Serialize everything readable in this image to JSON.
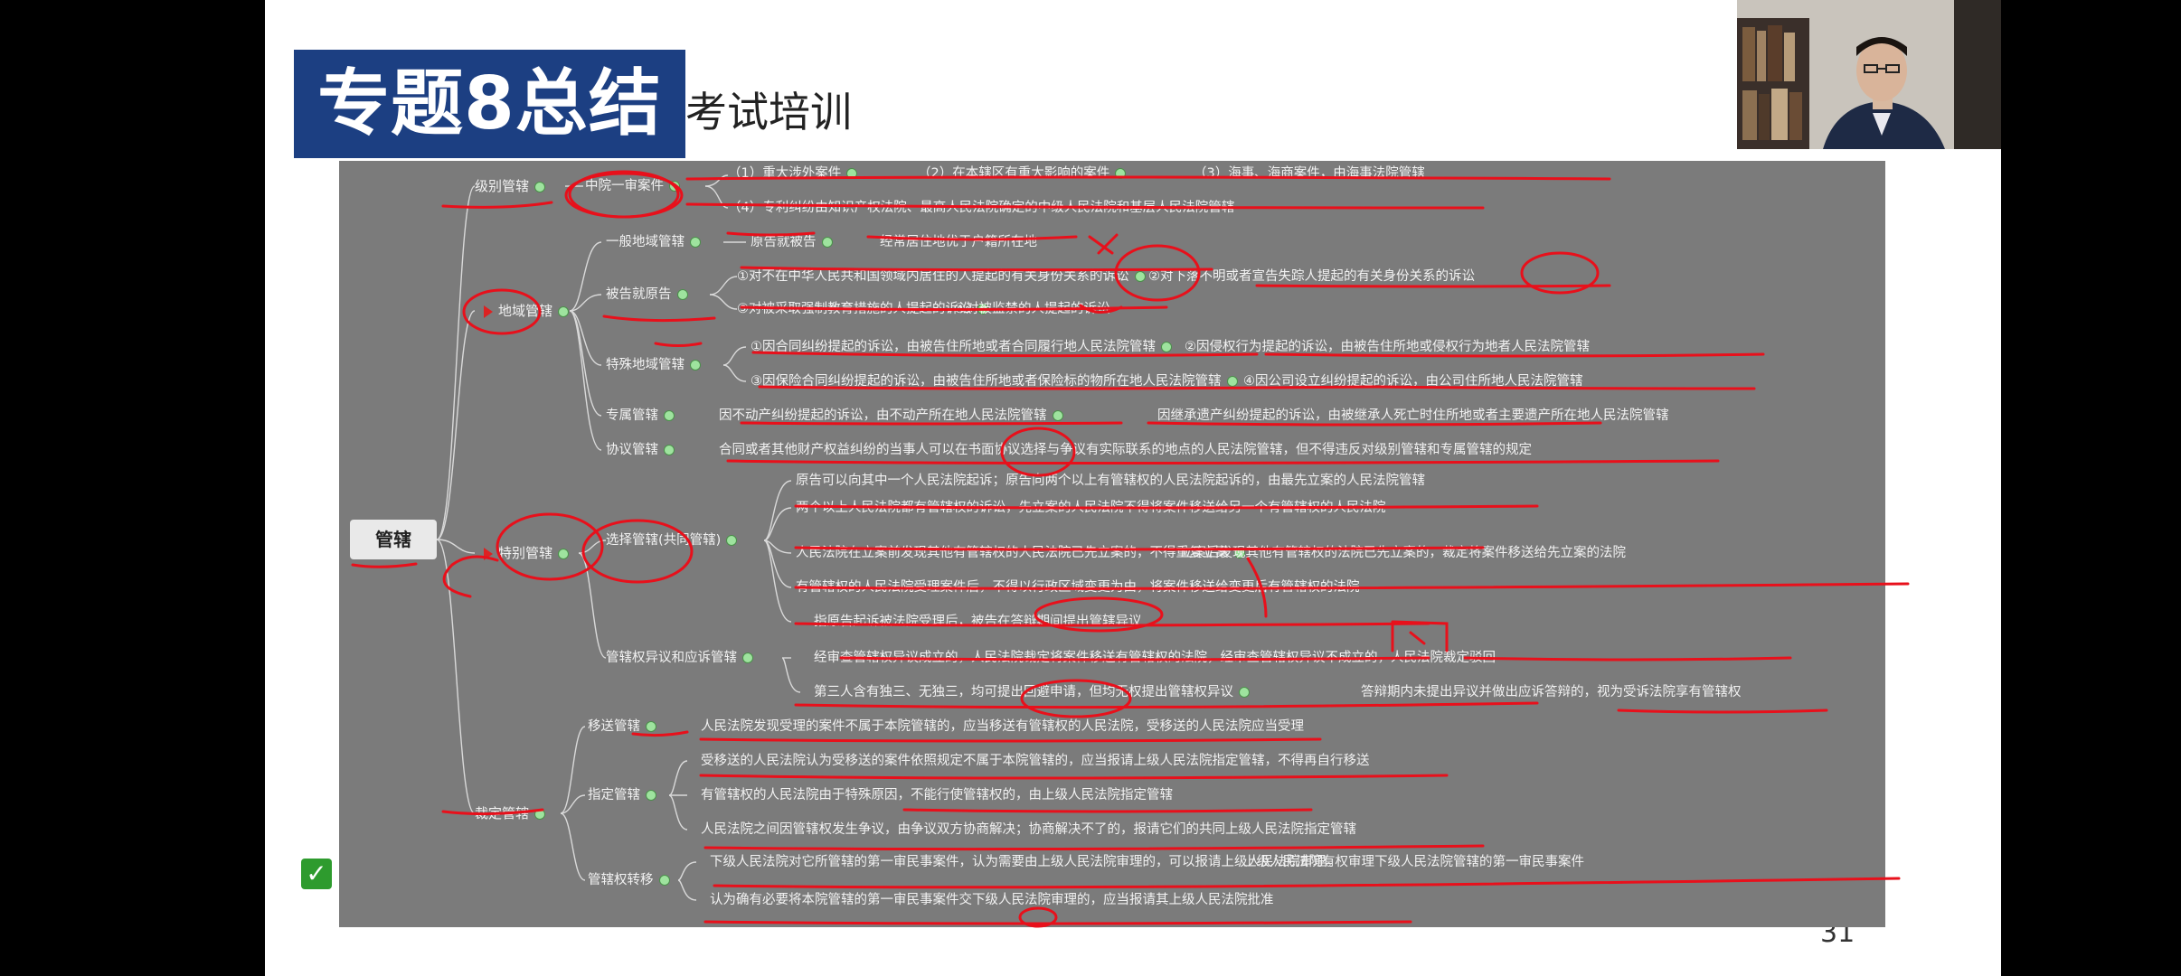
{
  "slide": {
    "title": "专题8总结",
    "subtitle": "考试培训",
    "page_number": "31"
  },
  "mindmap": {
    "root": "管辖",
    "level_jurisdiction": {
      "label": "级别管辖",
      "middle_court": "中院一审案件",
      "items": [
        "（1）重大涉外案件",
        "（2）在本辖区有重大影响的案件",
        "（3）海事、海商案件，由海事法院管辖",
        "（4）专利纠纷由知识产权法院、最高人民法院确定的中级人民法院和基层人民法院管辖"
      ]
    },
    "territorial": {
      "label": "地域管辖",
      "general": {
        "label": "一般地域管辖",
        "items": [
          "原告就被告",
          "经常居住地优于户籍所在地"
        ]
      },
      "defendant_follows_plaintiff": {
        "label": "被告就原告",
        "items": [
          "①对不在中华人民共和国领域内居住的人提起的有关身份关系的诉讼",
          "②对下落不明或者宣告失踪人提起的有关身份关系的诉讼",
          "③对被采取强制教育措施的人提起的诉讼",
          "④对被监禁的人提起的诉讼"
        ]
      },
      "special": {
        "label": "特殊地域管辖",
        "items": [
          "①因合同纠纷提起的诉讼，由被告住所地或者合同履行地人民法院管辖",
          "②因侵权行为提起的诉讼，由被告住所地或侵权行为地者人民法院管辖",
          "③因保险合同纠纷提起的诉讼，由被告住所地或者保险标的物所在地人民法院管辖",
          "④因公司设立纠纷提起的诉讼，由公司住所地人民法院管辖"
        ]
      },
      "exclusive": {
        "label": "专属管辖",
        "items": [
          "因不动产纠纷提起的诉讼，由不动产所在地人民法院管辖",
          "因继承遗产纠纷提起的诉讼，由被继承人死亡时住所地或者主要遗产所在地人民法院管辖"
        ]
      },
      "agreement": {
        "label": "协议管辖",
        "text": "合同或者其他财产权益纠纷的当事人可以在书面协议选择与争议有实际联系的地点的人民法院管辖，但不得违反对级别管辖和专属管辖的规定"
      }
    },
    "special_jurisdiction": {
      "label": "特别管辖",
      "selective": {
        "label": "选择管辖(共同管辖)",
        "items": [
          "原告可以向其中一个人民法院起诉；原告向两个以上有管辖权的人民法院起诉的，由最先立案的人民法院管辖",
          "两个以上人民法院都有管辖权的诉讼，先立案的人民法院不得将案件移送给另一个有管辖权的人民法院",
          "人民法院在立案前发现其他有管辖权的人民法院已先立案的，不得重复立案",
          "立案后发现其他有管辖权的法院已先立案的，裁定将案件移送给先立案的法院",
          "有管辖权的人民法院受理案件后，不得以行政区域变更为由，将案件移送给变更后有管辖权的法院",
          "指原告起诉被法院受理后，被告在答辩期间提出管辖异议"
        ]
      },
      "objection": {
        "label": "管辖权异议和应诉管辖",
        "items": [
          "经审查管辖权异议成立的，人民法院裁定将案件移送有管辖权的法院，经审查管辖权异议不成立的，人民法院裁定驳回",
          "第三人含有独三、无独三，均可提出回避申请，但均无权提出管辖权异议",
          "答辩期内未提出异议并做出应诉答辩的，视为受诉法院享有管辖权"
        ]
      }
    },
    "ruling_jurisdiction": {
      "label": "裁定管辖",
      "transfer": {
        "label": "移送管辖",
        "text": "人民法院发现受理的案件不属于本院管辖的，应当移送有管辖权的人民法院，受移送的人民法院应当受理"
      },
      "designated": {
        "label": "指定管辖",
        "items": [
          "受移送的人民法院认为受移送的案件依照规定不属于本院管辖的，应当报请上级人民法院指定管辖，不得再自行移送",
          "有管辖权的人民法院由于特殊原因，不能行使管辖权的，由上级人民法院指定管辖",
          "人民法院之间因管辖权发生争议，由争议双方协商解决；协商解决不了的，报请它们的共同上级人民法院指定管辖"
        ]
      },
      "shift": {
        "label": "管辖权转移",
        "items": [
          "下级人民法院对它所管辖的第一审民事案件，认为需要由上级人民法院审理的，可以报请上级人民法院审理。",
          "上级人民法院有权审理下级人民法院管辖的第一审民事案件",
          "认为确有必要将本院管辖的第一审民事案件交下级人民法院审理的，应当报请其上级人民法院批准"
        ]
      }
    }
  },
  "colors": {
    "title_bg": "#1c3f82",
    "mindmap_bg": "#7b7b7b",
    "annotation_red": "#e8101b",
    "node_dot": "#9ee39e"
  },
  "icons": [
    "checkmark-icon",
    "flag-icon",
    "presenter-webcam"
  ]
}
